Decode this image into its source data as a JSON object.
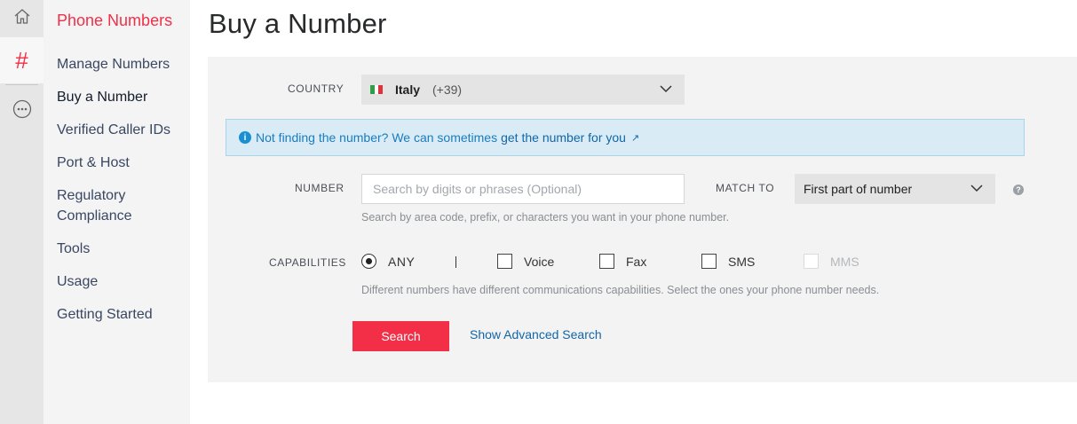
{
  "rail": {
    "icons": [
      "home-icon",
      "hash-icon",
      "more-icon"
    ]
  },
  "subnav": {
    "title": "Phone Numbers",
    "items": [
      {
        "label": "Manage Numbers"
      },
      {
        "label": "Buy a Number"
      },
      {
        "label": "Verified Caller IDs"
      },
      {
        "label": "Port & Host"
      },
      {
        "label": "Regulatory"
      },
      {
        "label": "Compliance"
      },
      {
        "label": "Tools"
      },
      {
        "label": "Usage"
      },
      {
        "label": "Getting Started"
      }
    ]
  },
  "page": {
    "title": "Buy a Number"
  },
  "form": {
    "country": {
      "label": "COUNTRY",
      "name": "Italy",
      "code": "(+39)"
    },
    "info": {
      "text": "Not finding the number? We can sometimes",
      "link": "get the number for you"
    },
    "number": {
      "label": "NUMBER",
      "placeholder": "Search by digits or phrases (Optional)",
      "help": "Search by area code, prefix, or characters you want in your phone number."
    },
    "match": {
      "label": "MATCH TO",
      "value": "First part of number"
    },
    "capabilities": {
      "label": "CAPABILITIES",
      "options": [
        {
          "label": "ANY",
          "type": "radio",
          "checked": true
        },
        {
          "label": "Voice",
          "type": "checkbox",
          "checked": false
        },
        {
          "label": "Fax",
          "type": "checkbox",
          "checked": false
        },
        {
          "label": "SMS",
          "type": "checkbox",
          "checked": false
        },
        {
          "label": "MMS",
          "type": "checkbox",
          "checked": false,
          "disabled": true
        }
      ],
      "help": "Different numbers have different communications capabilities. Select the ones your phone number needs."
    },
    "actions": {
      "search": "Search",
      "advanced": "Show Advanced Search"
    }
  },
  "colors": {
    "brand": "#f22f46",
    "link": "#1266a8",
    "banner_bg": "#d9ecf5",
    "panel_bg": "#f3f3f3"
  }
}
